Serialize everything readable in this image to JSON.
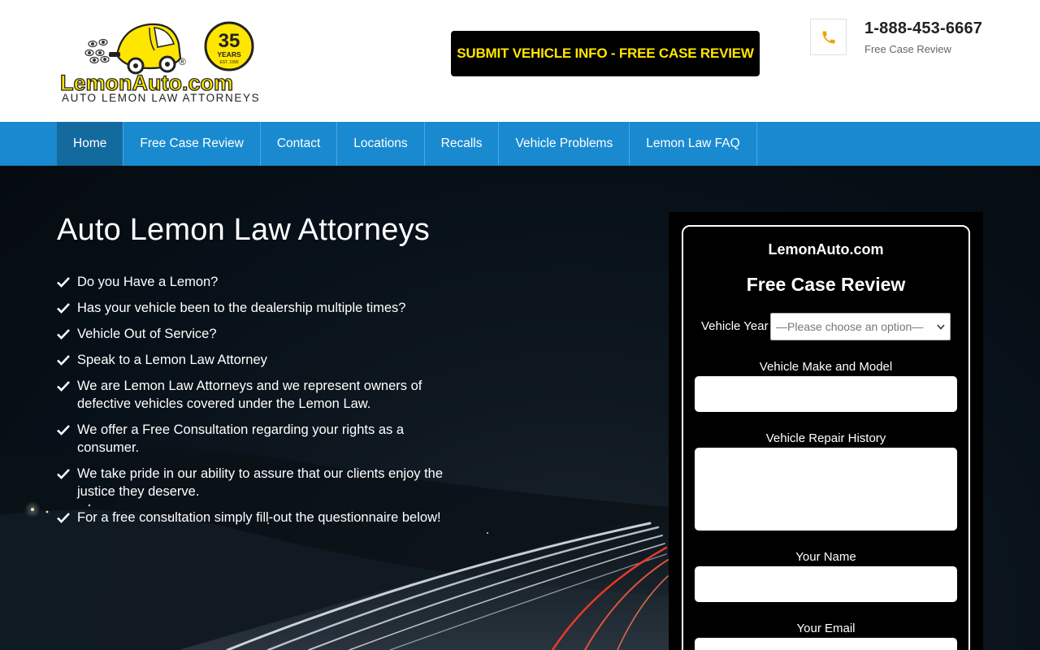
{
  "header": {
    "logo": {
      "brand": "LemonAuto.com",
      "tagline": "AUTO LEMON LAW ATTORNEYS",
      "badge_number": "35",
      "badge_word": "YEARS",
      "badge_est": "EST. 1990",
      "registered": "®"
    },
    "cta_label": "SUBMIT VEHICLE INFO - FREE CASE REVIEW",
    "phone_icon": "phone-icon",
    "phone_number": "1-888-453-6667",
    "phone_sub": "Free Case Review",
    "accent_color": "#ffe600"
  },
  "nav": {
    "items": [
      {
        "label": "Home",
        "active": true
      },
      {
        "label": "Free Case Review"
      },
      {
        "label": "Contact"
      },
      {
        "label": "Locations"
      },
      {
        "label": "Recalls"
      },
      {
        "label": "Vehicle Problems"
      },
      {
        "label": "Lemon Law FAQ"
      }
    ],
    "bg_color": "#1a8ad0"
  },
  "hero": {
    "title": "Auto Lemon Law Attorneys",
    "bullets": [
      "Do you Have a Lemon?",
      "Has your vehicle been to the dealership multiple times?",
      "Vehicle Out of Service?",
      "Speak to a Lemon Law Attorney",
      "We are Lemon Law Attorneys and we represent owners of defective vehicles covered under the Lemon Law.",
      "We offer a Free Consultation regarding your rights as a consumer.",
      "We take pride in our ability to assure that our clients enjoy the justice they deserve.",
      "For a free consultation simply fill-out the questionnaire below!"
    ]
  },
  "form": {
    "site": "LemonAuto.com",
    "title": "Free Case Review",
    "year_label": "Vehicle Year",
    "year_placeholder": "—Please choose an option—",
    "make_label": "Vehicle Make and Model",
    "repair_label": "Vehicle Repair History",
    "name_label": "Your Name",
    "email_label": "Your Email"
  }
}
